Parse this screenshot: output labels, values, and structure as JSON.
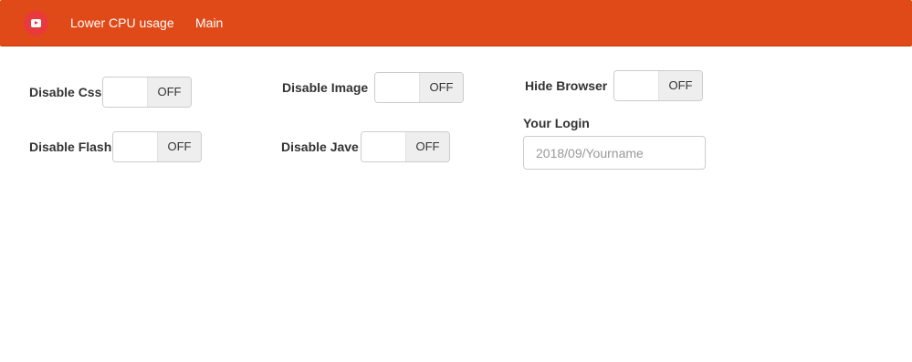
{
  "navbar": {
    "logo_icon": "youtube-play-icon",
    "links": [
      "Lower CPU usage",
      "Main"
    ],
    "bg_color": "#e04a18"
  },
  "toggles": {
    "disable_css": {
      "label": "Disable Css",
      "state": "OFF"
    },
    "disable_image": {
      "label": "Disable Image",
      "state": "OFF"
    },
    "hide_browser": {
      "label": "Hide Browser",
      "state": "OFF"
    },
    "disable_flash": {
      "label": "Disable Flash",
      "state": "OFF"
    },
    "disable_jave": {
      "label": "Disable Jave",
      "state": "OFF"
    }
  },
  "login": {
    "label": "Your Login",
    "placeholder": "2018/09/Yourname",
    "value": ""
  }
}
